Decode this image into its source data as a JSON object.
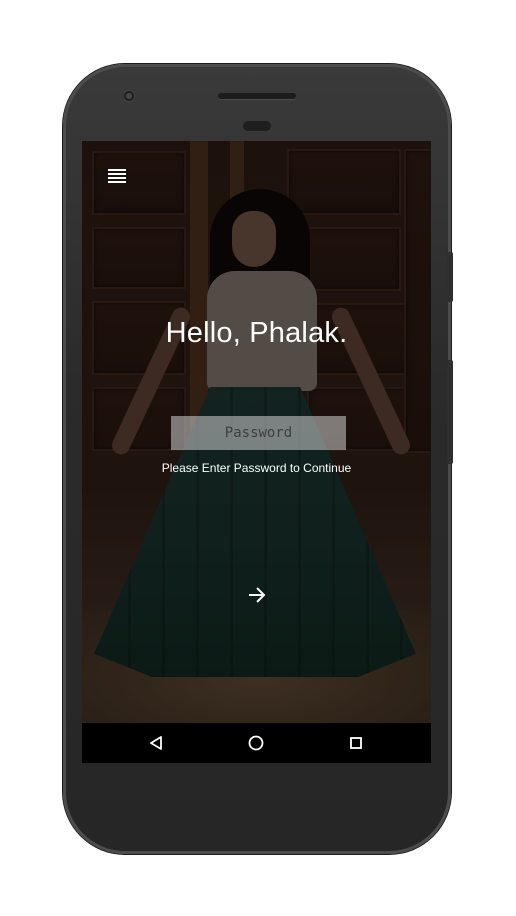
{
  "greeting": {
    "text": "Hello, Phalak."
  },
  "login": {
    "password_placeholder": "Password",
    "hint": "Please Enter Password to Continue"
  },
  "icons": {
    "menu": "hamburger-menu-icon",
    "submit": "arrow-right-icon",
    "back": "nav-back-icon",
    "home": "nav-home-icon",
    "recent": "nav-recent-apps-icon"
  },
  "colors": {
    "text": "#ffffff",
    "input_background": "#c8c8c8",
    "nav_bar": "#000000",
    "device_body": "#2b2b2b"
  }
}
